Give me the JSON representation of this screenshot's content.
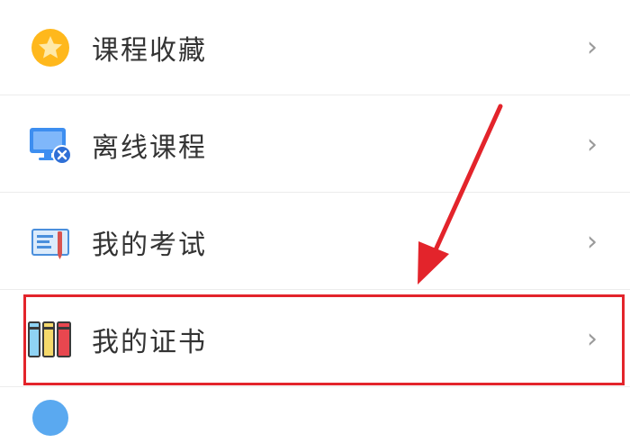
{
  "menu": {
    "items": [
      {
        "label": "课程收藏",
        "icon": "star-badge-icon"
      },
      {
        "label": "离线课程",
        "icon": "offline-monitor-icon"
      },
      {
        "label": "我的考试",
        "icon": "exam-card-icon"
      },
      {
        "label": "我的证书",
        "icon": "certificate-books-icon"
      },
      {
        "label": "",
        "icon": "partial-circle-icon"
      }
    ],
    "chevron": "›"
  },
  "annotation": {
    "box_color": "#e3242b",
    "arrow_color": "#e3242b"
  }
}
